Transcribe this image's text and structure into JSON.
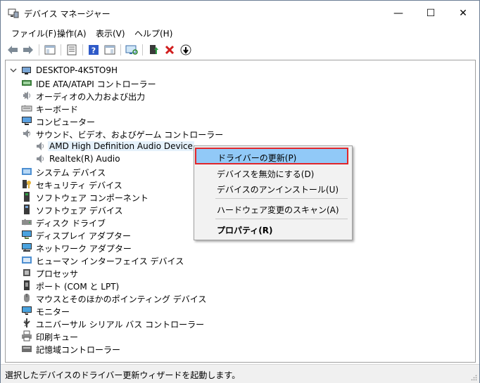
{
  "window": {
    "title": "デバイス マネージャー",
    "minimize_glyph": "—",
    "maximize_glyph": "☐",
    "close_glyph": "✕"
  },
  "menu": [
    "ファイル(F)",
    "操作(A)",
    "表示(V)",
    "ヘルプ(H)"
  ],
  "toolbar_icons": [
    "back-arrow-icon",
    "forward-arrow-icon",
    "show-hide-console-tree-icon",
    "properties-icon",
    "help-icon",
    "action-pane-icon",
    "scan-hardware-icon",
    "update-driver-icon",
    "uninstall-device-icon",
    "disable-device-icon"
  ],
  "tree": {
    "root": "DESKTOP-4K5TO9H",
    "items": [
      {
        "label": "IDE ATA/ATAPI コントローラー",
        "icon": "ide-controller-icon",
        "expanded": false
      },
      {
        "label": "オーディオの入力および出力",
        "icon": "speaker-icon",
        "expanded": false
      },
      {
        "label": "キーボード",
        "icon": "keyboard-icon",
        "expanded": false
      },
      {
        "label": "コンピューター",
        "icon": "computer-icon",
        "expanded": false
      },
      {
        "label": "サウンド、ビデオ、およびゲーム コントローラー",
        "icon": "speaker-icon",
        "expanded": true
      },
      {
        "label": "AMD High Definition Audio Device",
        "icon": "speaker-icon",
        "child": true,
        "selected": true
      },
      {
        "label": "Realtek(R) Audio",
        "icon": "speaker-icon",
        "child": true
      },
      {
        "label": "システム デバイス",
        "icon": "system-device-icon",
        "expanded": false
      },
      {
        "label": "セキュリティ デバイス",
        "icon": "security-key-icon",
        "expanded": false
      },
      {
        "label": "ソフトウェア コンポーネント",
        "icon": "software-component-icon",
        "expanded": false
      },
      {
        "label": "ソフトウェア デバイス",
        "icon": "software-device-icon",
        "expanded": false
      },
      {
        "label": "ディスク ドライブ",
        "icon": "disk-drive-icon",
        "expanded": false
      },
      {
        "label": "ディスプレイ アダプター",
        "icon": "display-adapter-icon",
        "expanded": false
      },
      {
        "label": "ネットワーク アダプター",
        "icon": "network-adapter-icon",
        "expanded": false
      },
      {
        "label": "ヒューマン インターフェイス デバイス",
        "icon": "hid-icon",
        "expanded": false
      },
      {
        "label": "プロセッサ",
        "icon": "processor-icon",
        "expanded": false
      },
      {
        "label": "ポート (COM と LPT)",
        "icon": "port-icon",
        "expanded": false
      },
      {
        "label": "マウスとそのほかのポインティング デバイス",
        "icon": "mouse-icon",
        "expanded": false
      },
      {
        "label": "モニター",
        "icon": "monitor-icon",
        "expanded": false
      },
      {
        "label": "ユニバーサル シリアル バス コントローラー",
        "icon": "usb-icon",
        "expanded": false
      },
      {
        "label": "印刷キュー",
        "icon": "printer-icon",
        "expanded": false
      },
      {
        "label": "記憶域コントローラー",
        "icon": "storage-controller-icon",
        "expanded": false
      }
    ]
  },
  "context_menu": {
    "update_driver": "ドライバーの更新(P)",
    "disable_device": "デバイスを無効にする(D)",
    "uninstall_device": "デバイスのアンインストール(U)",
    "scan_hardware": "ハードウェア変更のスキャン(A)",
    "properties": "プロパティ(R)"
  },
  "status": "選択したデバイスのドライバー更新ウィザードを起動します。",
  "colors": {
    "selection": "#e5f1fb",
    "menu_highlight": "#91c9f7",
    "annotation_box": "#e0262b"
  }
}
